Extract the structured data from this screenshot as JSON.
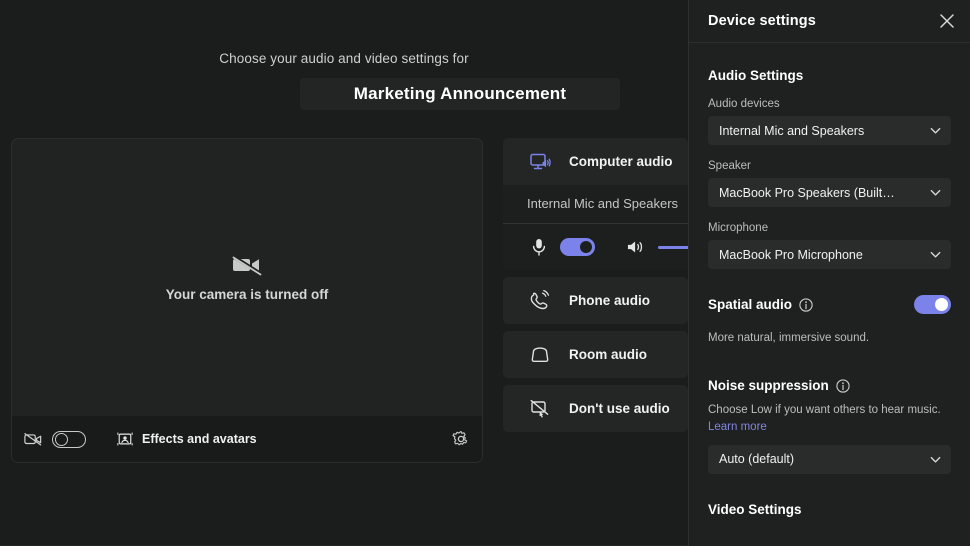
{
  "prejoin": {
    "subtitle": "Choose your audio and video settings for",
    "meeting_title": "Marketing Announcement",
    "preview": {
      "camera_off_message": "Your camera is turned off",
      "camera_icon": "camera-off-icon",
      "toolbar": {
        "camera_icon": "camera-off-icon",
        "camera_toggle_state": "off",
        "effects_icon": "effects-avatars-icon",
        "effects_label": "Effects and avatars",
        "settings_icon": "gear-icon"
      }
    },
    "audio_options": [
      {
        "id": "computer-audio",
        "icon": "computer-audio-icon",
        "label": "Computer audio",
        "selected": true,
        "detail": {
          "device_name": "Internal Mic and Speakers",
          "mic_icon": "microphone-icon",
          "mic_toggle_state": "on",
          "speaker_icon": "speaker-icon",
          "volume_level": 100
        }
      },
      {
        "id": "phone-audio",
        "icon": "phone-audio-icon",
        "label": "Phone audio",
        "selected": false
      },
      {
        "id": "room-audio",
        "icon": "room-audio-icon",
        "label": "Room audio",
        "selected": false
      },
      {
        "id": "no-audio",
        "icon": "no-audio-icon",
        "label": "Don't use audio",
        "selected": false
      }
    ]
  },
  "device_settings": {
    "title": "Device settings",
    "close_icon": "close-icon",
    "audio_section_title": "Audio Settings",
    "audio_devices": {
      "label": "Audio devices",
      "value": "Internal Mic and Speakers",
      "chevron_icon": "chevron-down-icon"
    },
    "speaker": {
      "label": "Speaker",
      "value": "MacBook Pro Speakers (Built…",
      "chevron_icon": "chevron-down-icon"
    },
    "microphone": {
      "label": "Microphone",
      "value": "MacBook Pro Microphone",
      "chevron_icon": "chevron-down-icon"
    },
    "spatial_audio": {
      "label": "Spatial audio",
      "info_icon": "info-icon",
      "toggle_state": "on",
      "description": "More natural, immersive sound."
    },
    "noise_suppression": {
      "label": "Noise suppression",
      "info_icon": "info-icon",
      "description_prefix": "Choose Low if you want others to hear music. ",
      "link_label": "Learn more",
      "value": "Auto (default)",
      "chevron_icon": "chevron-down-icon"
    },
    "video_section_title": "Video Settings"
  },
  "colors": {
    "accent": "#7b83eb",
    "link": "#8086e0",
    "panel_bg": "#1f2020",
    "stage_bg": "#1b1c1c",
    "card_bg": "#242525"
  }
}
